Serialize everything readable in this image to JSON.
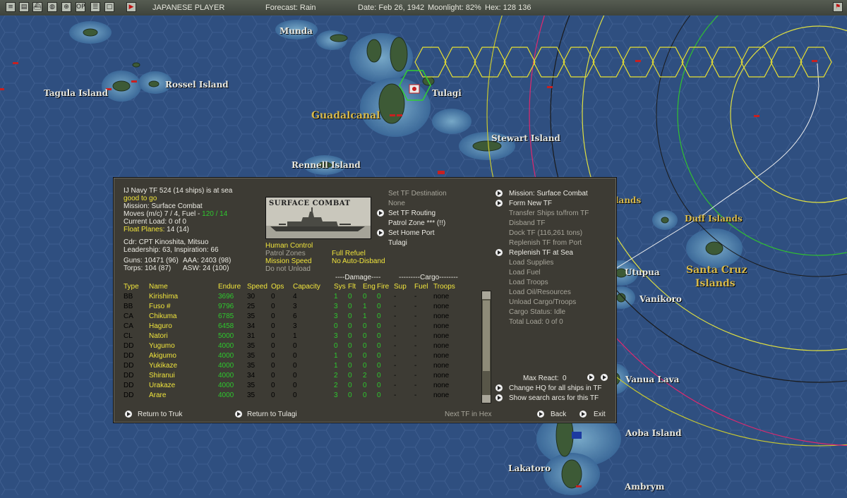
{
  "topbar": {
    "player": "JAPANESE PLAYER",
    "forecast": "Forecast: Rain",
    "date": "Date: Feb 26, 1942",
    "moonlight": "Moonlight: 82%",
    "hex": "Hex: 128 136"
  },
  "map_labels": {
    "munda": "Munda",
    "tagula": "Tagula Island",
    "rossel": "Rossel Island",
    "tulagi": "Tulagi",
    "guadalcanal": "Guadalcanal",
    "stewart": "Stewart Island",
    "rennell": "Rennell Island",
    "duff": "Duff Islands",
    "santa_cruz_1": "Santa Cruz",
    "santa_cruz_2": "Islands",
    "utupua": "Utupua",
    "vanikoro": "Vanikoro",
    "vanua_lava": "Vanua Lava",
    "aoba": "Aoba Island",
    "lakatoro": "Lakatoro",
    "ambrym": "Ambrym",
    "lands_fragment": "lands"
  },
  "tf": {
    "header": "IJ Navy TF 524 (14 ships) is at sea",
    "status": "good to go",
    "mission": "Mission: Surface Combat",
    "moves_prefix": "Moves (m/c) 7 / 4, Fuel - ",
    "fuel": "120 / 14",
    "current_load": "Current Load: 0 of 0",
    "float_planes_label": "Float Planes:",
    "float_planes_value": "14 (14)",
    "commander": "Cdr: CPT Kinoshita, Mitsuo",
    "leadership": "Leadership: 63, Inspiration: 66",
    "guns": "Guns: 10471 (96)",
    "aaa": "AAA: 2403 (98)",
    "torps": "Torps: 104 (87)",
    "asw": "ASW: 24 (100)",
    "image_caption": "SURFACE COMBAT"
  },
  "controls": {
    "human_control": "Human Control",
    "patrol_zones": "Patrol Zones",
    "mission_speed": "Mission Speed",
    "do_not_unload": "Do not Unload",
    "full_refuel": "Full Refuel",
    "no_auto_disband": "No Auto-Disband"
  },
  "routing": {
    "set_destination": "Set TF Destination",
    "destination_value": "None",
    "set_routing": "Set TF Routing",
    "patrol_zone": "Patrol Zone *** (!!)",
    "set_home_port": "Set Home Port",
    "home_port_value": "Tulagi"
  },
  "actions": {
    "mission": "Mission: Surface Combat",
    "form_new_tf": "Form New TF",
    "transfer_ships": "Transfer Ships to/from TF",
    "disband_tf": "Disband TF",
    "dock_tf": "Dock TF (116,261 tons)",
    "replenish_from_port": "Replenish TF from Port",
    "replenish_at_sea": "Replenish TF at Sea",
    "load_supplies": "Load Supplies",
    "load_fuel": "Load Fuel",
    "load_troops": "Load Troops",
    "load_oil": "Load Oil/Resources",
    "unload_cargo": "Unload Cargo/Troops",
    "cargo_status": "Cargo Status: Idle",
    "total_load": "Total Load: 0 of 0",
    "max_react_label": "Max React:",
    "max_react_value": "0",
    "change_hq": "Change HQ for all ships in TF",
    "show_search_arcs": "Show search arcs for this TF"
  },
  "table": {
    "group_damage": "----Damage----",
    "group_cargo": "---------Cargo--------",
    "headers": [
      "Type",
      "Name",
      "Endure",
      "Speed",
      "Ops",
      "Capacity",
      "Sys",
      "Flt",
      "Eng",
      "Fire",
      "Sup",
      "Fuel",
      "Troops"
    ],
    "rows": [
      [
        "BB",
        "Kirishima",
        "3696",
        "30",
        "0",
        "4",
        "1",
        "0",
        "0",
        "0",
        "-",
        "-",
        "none"
      ],
      [
        "BB",
        "Fuso #",
        "9796",
        "25",
        "0",
        "3",
        "3",
        "0",
        "1",
        "0",
        "-",
        "-",
        "none"
      ],
      [
        "CA",
        "Chikuma",
        "6785",
        "35",
        "0",
        "6",
        "3",
        "0",
        "1",
        "0",
        "-",
        "-",
        "none"
      ],
      [
        "CA",
        "Haguro",
        "6458",
        "34",
        "0",
        "3",
        "0",
        "0",
        "0",
        "0",
        "-",
        "-",
        "none"
      ],
      [
        "CL",
        "Natori",
        "5000",
        "31",
        "0",
        "1",
        "3",
        "0",
        "0",
        "0",
        "-",
        "-",
        "none"
      ],
      [
        "DD",
        "Yugumo",
        "4000",
        "35",
        "0",
        "0",
        "0",
        "0",
        "0",
        "0",
        "-",
        "-",
        "none"
      ],
      [
        "DD",
        "Akigumo",
        "4000",
        "35",
        "0",
        "0",
        "1",
        "0",
        "0",
        "0",
        "-",
        "-",
        "none"
      ],
      [
        "DD",
        "Yukikaze",
        "4000",
        "35",
        "0",
        "0",
        "1",
        "0",
        "0",
        "0",
        "-",
        "-",
        "none"
      ],
      [
        "DD",
        "Shiranui",
        "4000",
        "34",
        "0",
        "0",
        "2",
        "0",
        "2",
        "0",
        "-",
        "-",
        "none"
      ],
      [
        "DD",
        "Urakaze",
        "4000",
        "35",
        "0",
        "0",
        "2",
        "0",
        "0",
        "0",
        "-",
        "-",
        "none"
      ],
      [
        "DD",
        "Arare",
        "4000",
        "35",
        "0",
        "0",
        "3",
        "0",
        "0",
        "0",
        "-",
        "-",
        "none"
      ]
    ]
  },
  "footer": {
    "return_truk": "Return to Truk",
    "return_tulagi": "Return to Tulagi",
    "next_tf": "Next TF in Hex",
    "back": "Back",
    "exit": "Exit"
  },
  "colors": {
    "ocean": "#2f4f80",
    "panel": "#3d3b34",
    "highlight_yellow": "#f0e43c",
    "value_green": "#2ec82e",
    "disabled_gray": "#a7a59a",
    "map_label_gold": "#d6b84a"
  }
}
